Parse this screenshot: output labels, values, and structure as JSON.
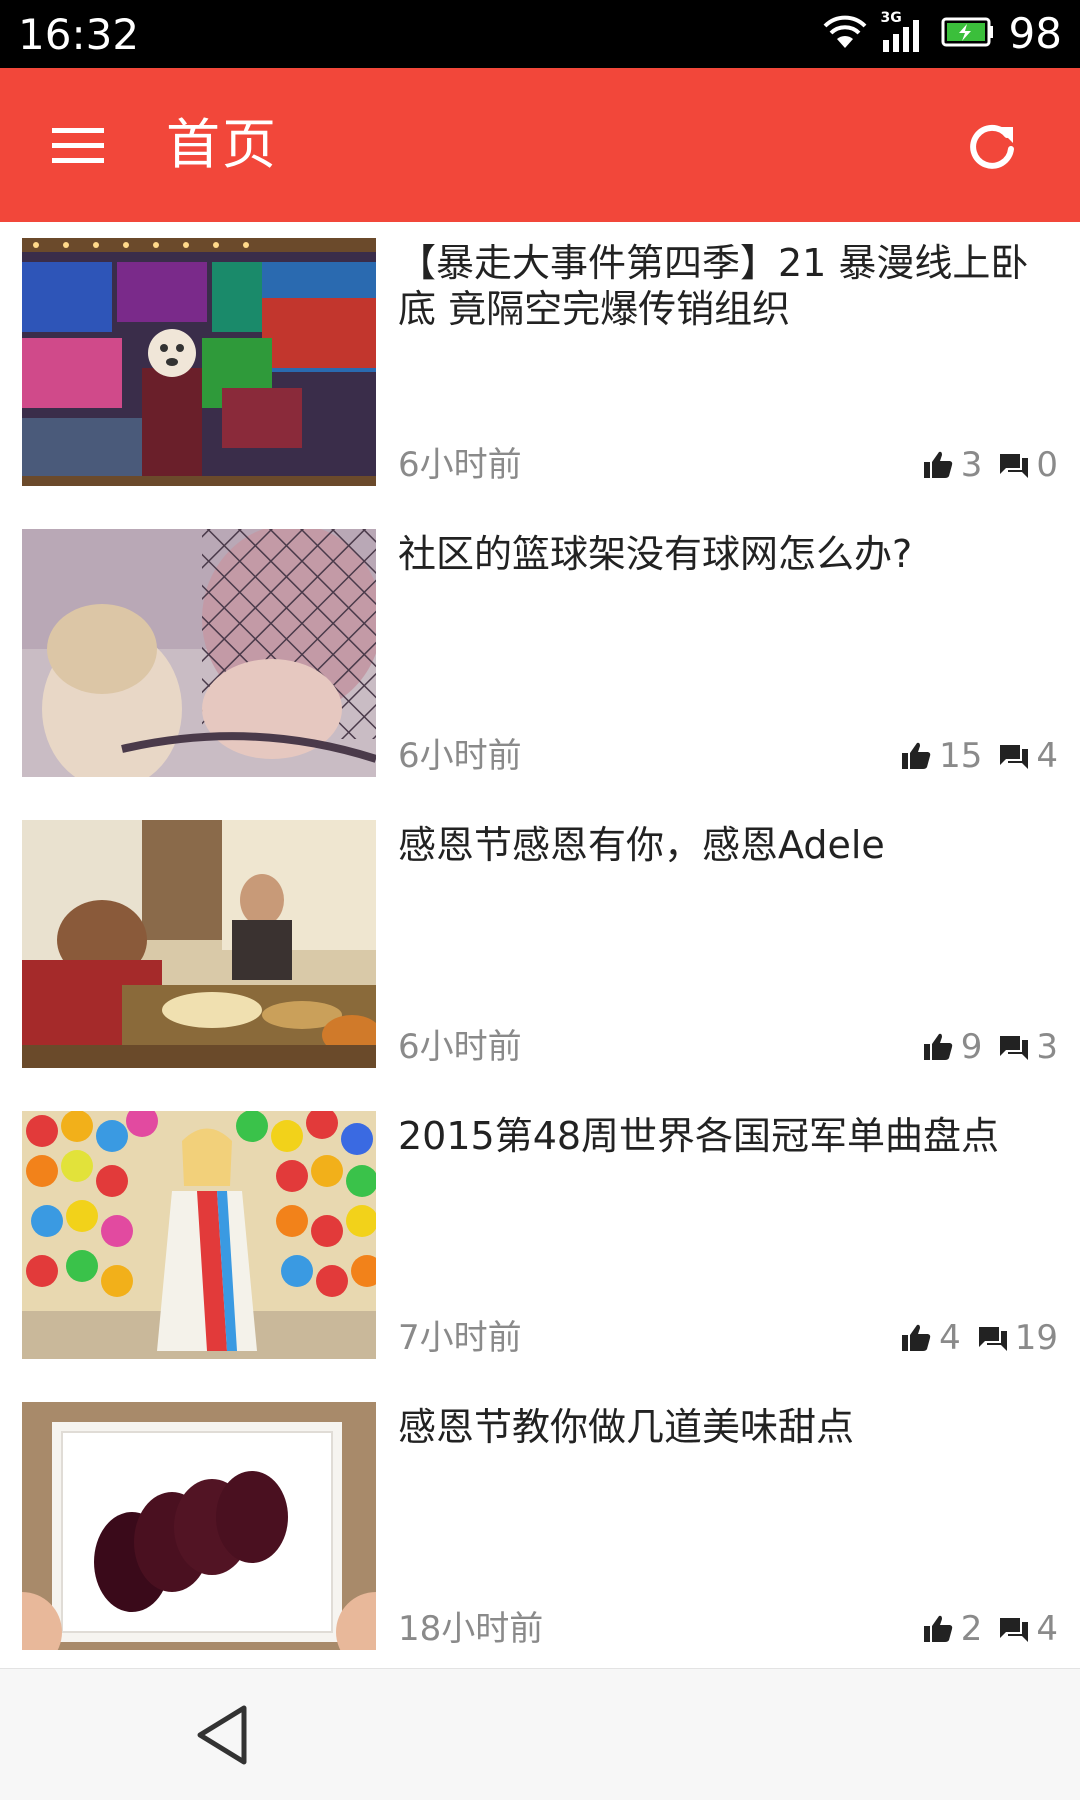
{
  "status_bar": {
    "time": "16:32",
    "network_label": "3G",
    "battery_percent": "98",
    "icons": [
      "wifi-icon",
      "signal-icon",
      "battery-icon"
    ]
  },
  "app_bar": {
    "title": "首页",
    "menu_icon": "menu-icon",
    "refresh_icon": "refresh-icon",
    "background_color": "#f2473a"
  },
  "feed": {
    "items": [
      {
        "title": "【暴走大事件第四季】21 暴漫线上卧底 竟隔空完爆传销组织",
        "time": "6小时前",
        "likes": "3",
        "comments": "0",
        "thumbnail_icon": "video-thumbnail"
      },
      {
        "title": "社区的篮球架没有球网怎么办?",
        "time": "6小时前",
        "likes": "15",
        "comments": "4",
        "thumbnail_icon": "video-thumbnail"
      },
      {
        "title": "感恩节感恩有你，感恩Adele",
        "time": "6小时前",
        "likes": "9",
        "comments": "3",
        "thumbnail_icon": "video-thumbnail"
      },
      {
        "title": "2015第48周世界各国冠军单曲盘点",
        "time": "7小时前",
        "likes": "4",
        "comments": "19",
        "thumbnail_icon": "video-thumbnail"
      },
      {
        "title": "感恩节教你做几道美味甜点",
        "time": "18小时前",
        "likes": "2",
        "comments": "4",
        "thumbnail_icon": "video-thumbnail"
      }
    ]
  },
  "nav_bar": {
    "back_icon": "back-triangle-icon"
  }
}
